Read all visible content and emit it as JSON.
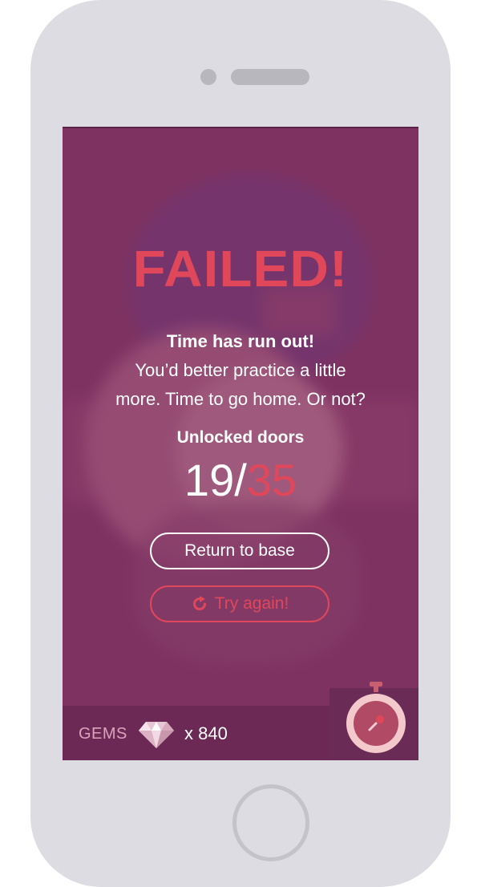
{
  "game_over": {
    "title": "FAILED!",
    "message_bold": "Time has run out!",
    "message_line1": "You’d better practice a little",
    "message_line2": "more. Time to go home. Or not?",
    "doors_label": "Unlocked doors",
    "doors_unlocked": "19",
    "doors_separator": "/",
    "doors_total": "35"
  },
  "buttons": {
    "return_label": "Return to base",
    "try_again_label": "Try again!"
  },
  "footer": {
    "gems_label": "GEMS",
    "gems_count": "x 840",
    "gem_icon": "diamond-icon",
    "timer_icon": "stopwatch-icon"
  },
  "colors": {
    "accent": "#e0475a",
    "screen_bg": "#7f3462",
    "bar_bg": "#6d2955",
    "frame": "#dcdce2"
  }
}
